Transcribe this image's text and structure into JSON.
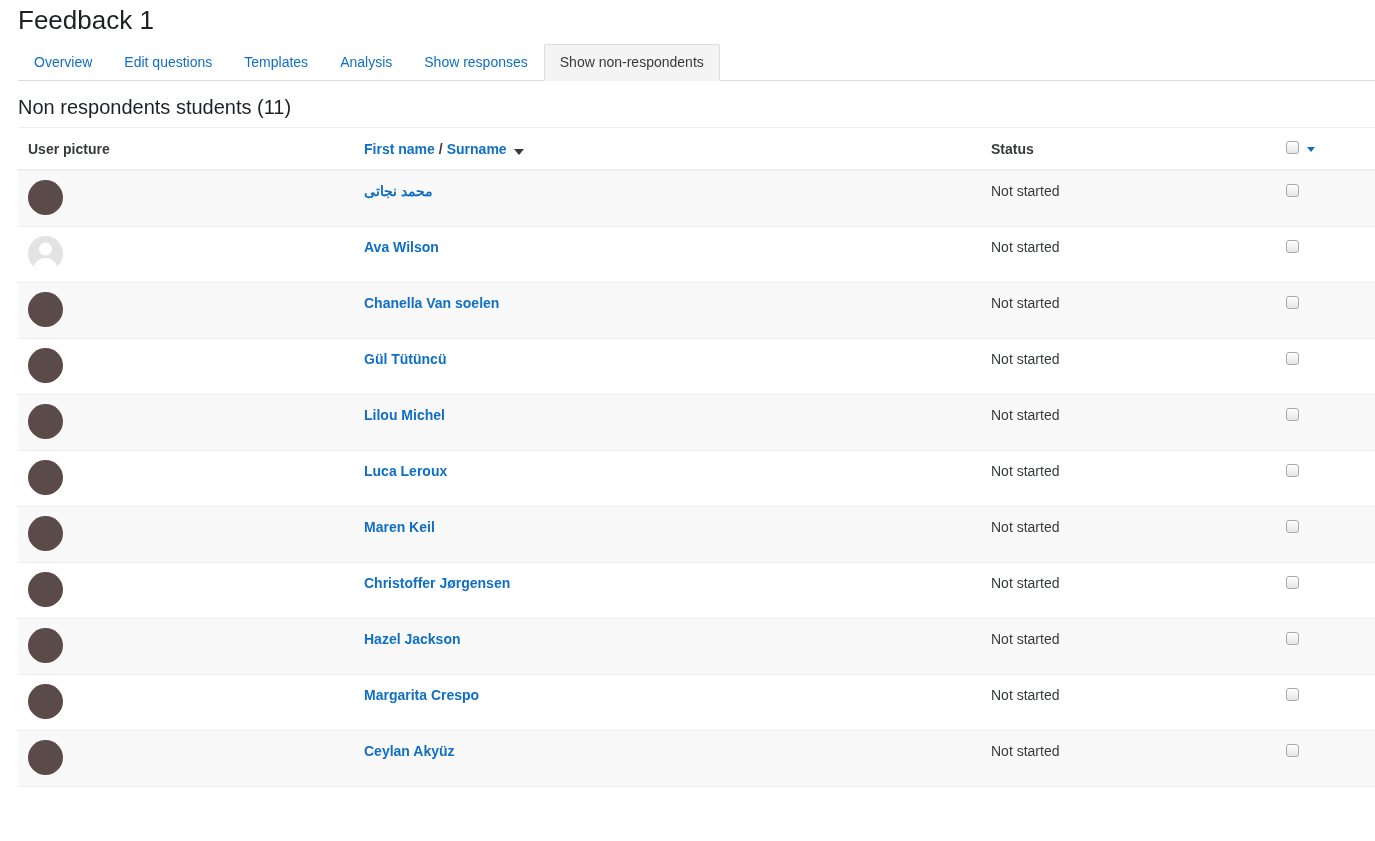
{
  "title": "Feedback 1",
  "tabs": [
    {
      "label": "Overview",
      "selected": false
    },
    {
      "label": "Edit questions",
      "selected": false
    },
    {
      "label": "Templates",
      "selected": false
    },
    {
      "label": "Analysis",
      "selected": false
    },
    {
      "label": "Show responses",
      "selected": false
    },
    {
      "label": "Show non-respondents",
      "selected": true
    }
  ],
  "heading": "Non respondents students (11)",
  "table": {
    "columns": {
      "picture": "User picture",
      "first_name": "First name",
      "separator": "/",
      "surname": "Surname",
      "status": "Status",
      "select_all_checked": false
    },
    "rows": [
      {
        "kind": "photo",
        "name": "محمد نجاتی",
        "status": "Not started",
        "checked": false
      },
      {
        "kind": "default",
        "name": "Ava Wilson",
        "status": "Not started",
        "checked": false
      },
      {
        "kind": "photo",
        "name": "Chanella Van soelen",
        "status": "Not started",
        "checked": false
      },
      {
        "kind": "photo",
        "name": "Gül Tütüncü",
        "status": "Not started",
        "checked": false
      },
      {
        "kind": "photo",
        "name": "Lilou Michel",
        "status": "Not started",
        "checked": false
      },
      {
        "kind": "photo",
        "name": "Luca Leroux",
        "status": "Not started",
        "checked": false
      },
      {
        "kind": "photo",
        "name": "Maren Keil",
        "status": "Not started",
        "checked": false
      },
      {
        "kind": "photo",
        "name": "Christoffer Jørgensen",
        "status": "Not started",
        "checked": false
      },
      {
        "kind": "photo",
        "name": "Hazel Jackson",
        "status": "Not started",
        "checked": false
      },
      {
        "kind": "photo",
        "name": "Margarita Crespo",
        "status": "Not started",
        "checked": false
      },
      {
        "kind": "photo",
        "name": "Ceylan Akyüz",
        "status": "Not started",
        "checked": false
      }
    ]
  }
}
